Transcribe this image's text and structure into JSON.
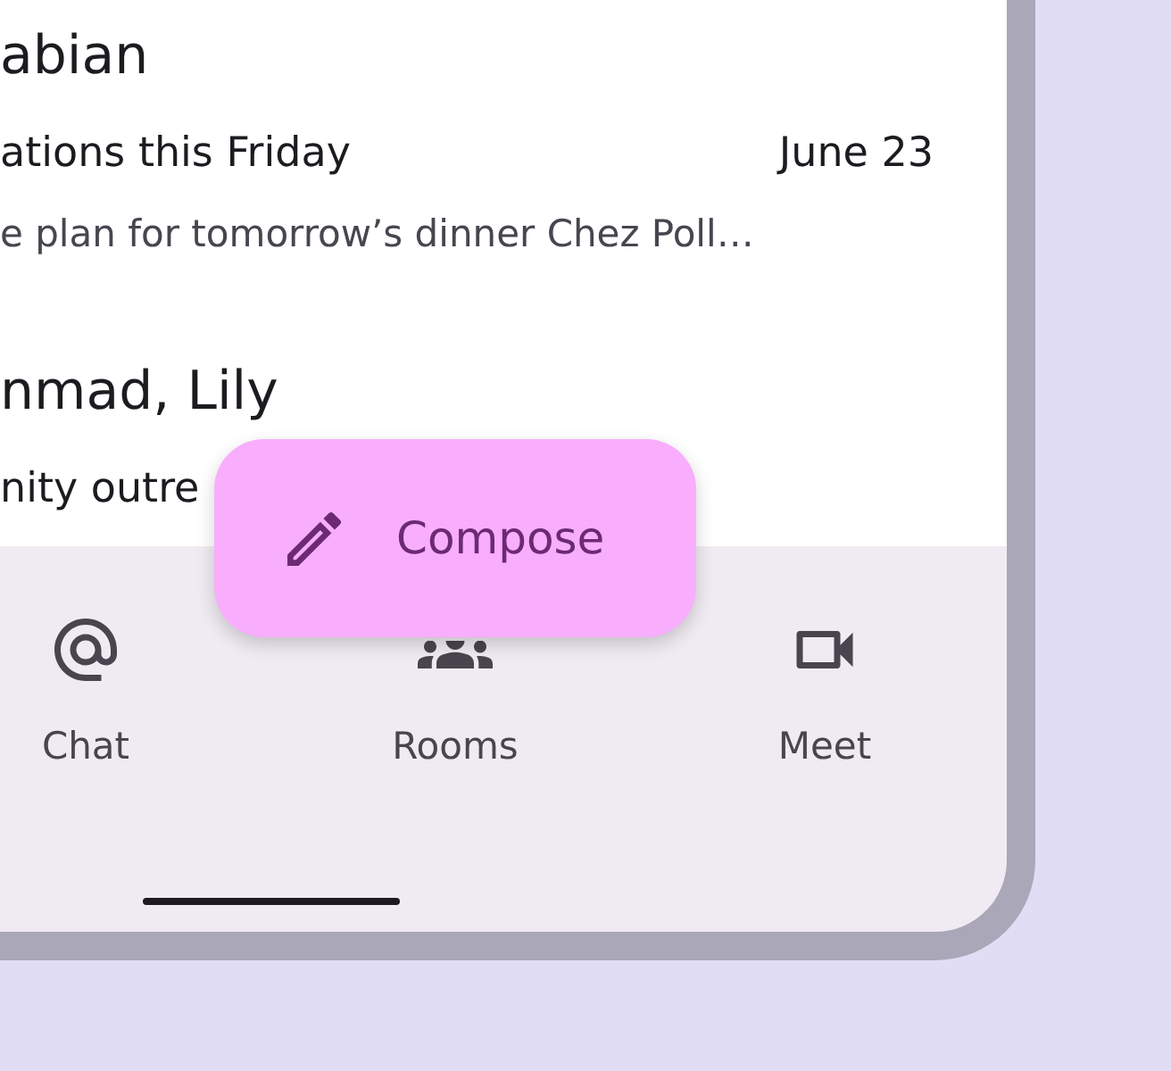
{
  "messages": [
    {
      "sender": "abian",
      "subject": "ations this Friday",
      "date": "June 23",
      "preview": "e plan for tomorrow’s dinner Chez Poll…"
    },
    {
      "sender": "nmad, Lily",
      "subject": "nity outre"
    }
  ],
  "fab": {
    "label": "Compose"
  },
  "nav": [
    {
      "label": "Chat"
    },
    {
      "label": "Rooms"
    },
    {
      "label": "Meet"
    }
  ]
}
